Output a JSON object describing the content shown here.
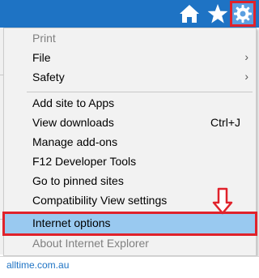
{
  "toolbar": {
    "icons": [
      "home-icon",
      "star-icon",
      "gear-icon"
    ],
    "background": "#1e73c4"
  },
  "menu": {
    "items": [
      {
        "label": "Print",
        "disabled": true
      },
      {
        "label": "File",
        "submenu": true,
        "arrow": "›"
      },
      {
        "label": "Safety",
        "submenu": true,
        "arrow": "›"
      },
      {
        "label": "Add site to Apps"
      },
      {
        "label": "View downloads",
        "shortcut": "Ctrl+J"
      },
      {
        "label": "Manage add-ons"
      },
      {
        "label": "F12 Developer Tools"
      },
      {
        "label": "Go to pinned sites"
      },
      {
        "label": "Compatibility View settings"
      },
      {
        "label": "Internet options",
        "highlighted": true
      },
      {
        "label": "About Internet Explorer",
        "disabled": true
      }
    ]
  },
  "annotations": {
    "highlight_color": "#e0222b",
    "arrows": [
      "up-arrow",
      "down-arrow"
    ]
  },
  "status": {
    "site": "alltime.com.au"
  }
}
